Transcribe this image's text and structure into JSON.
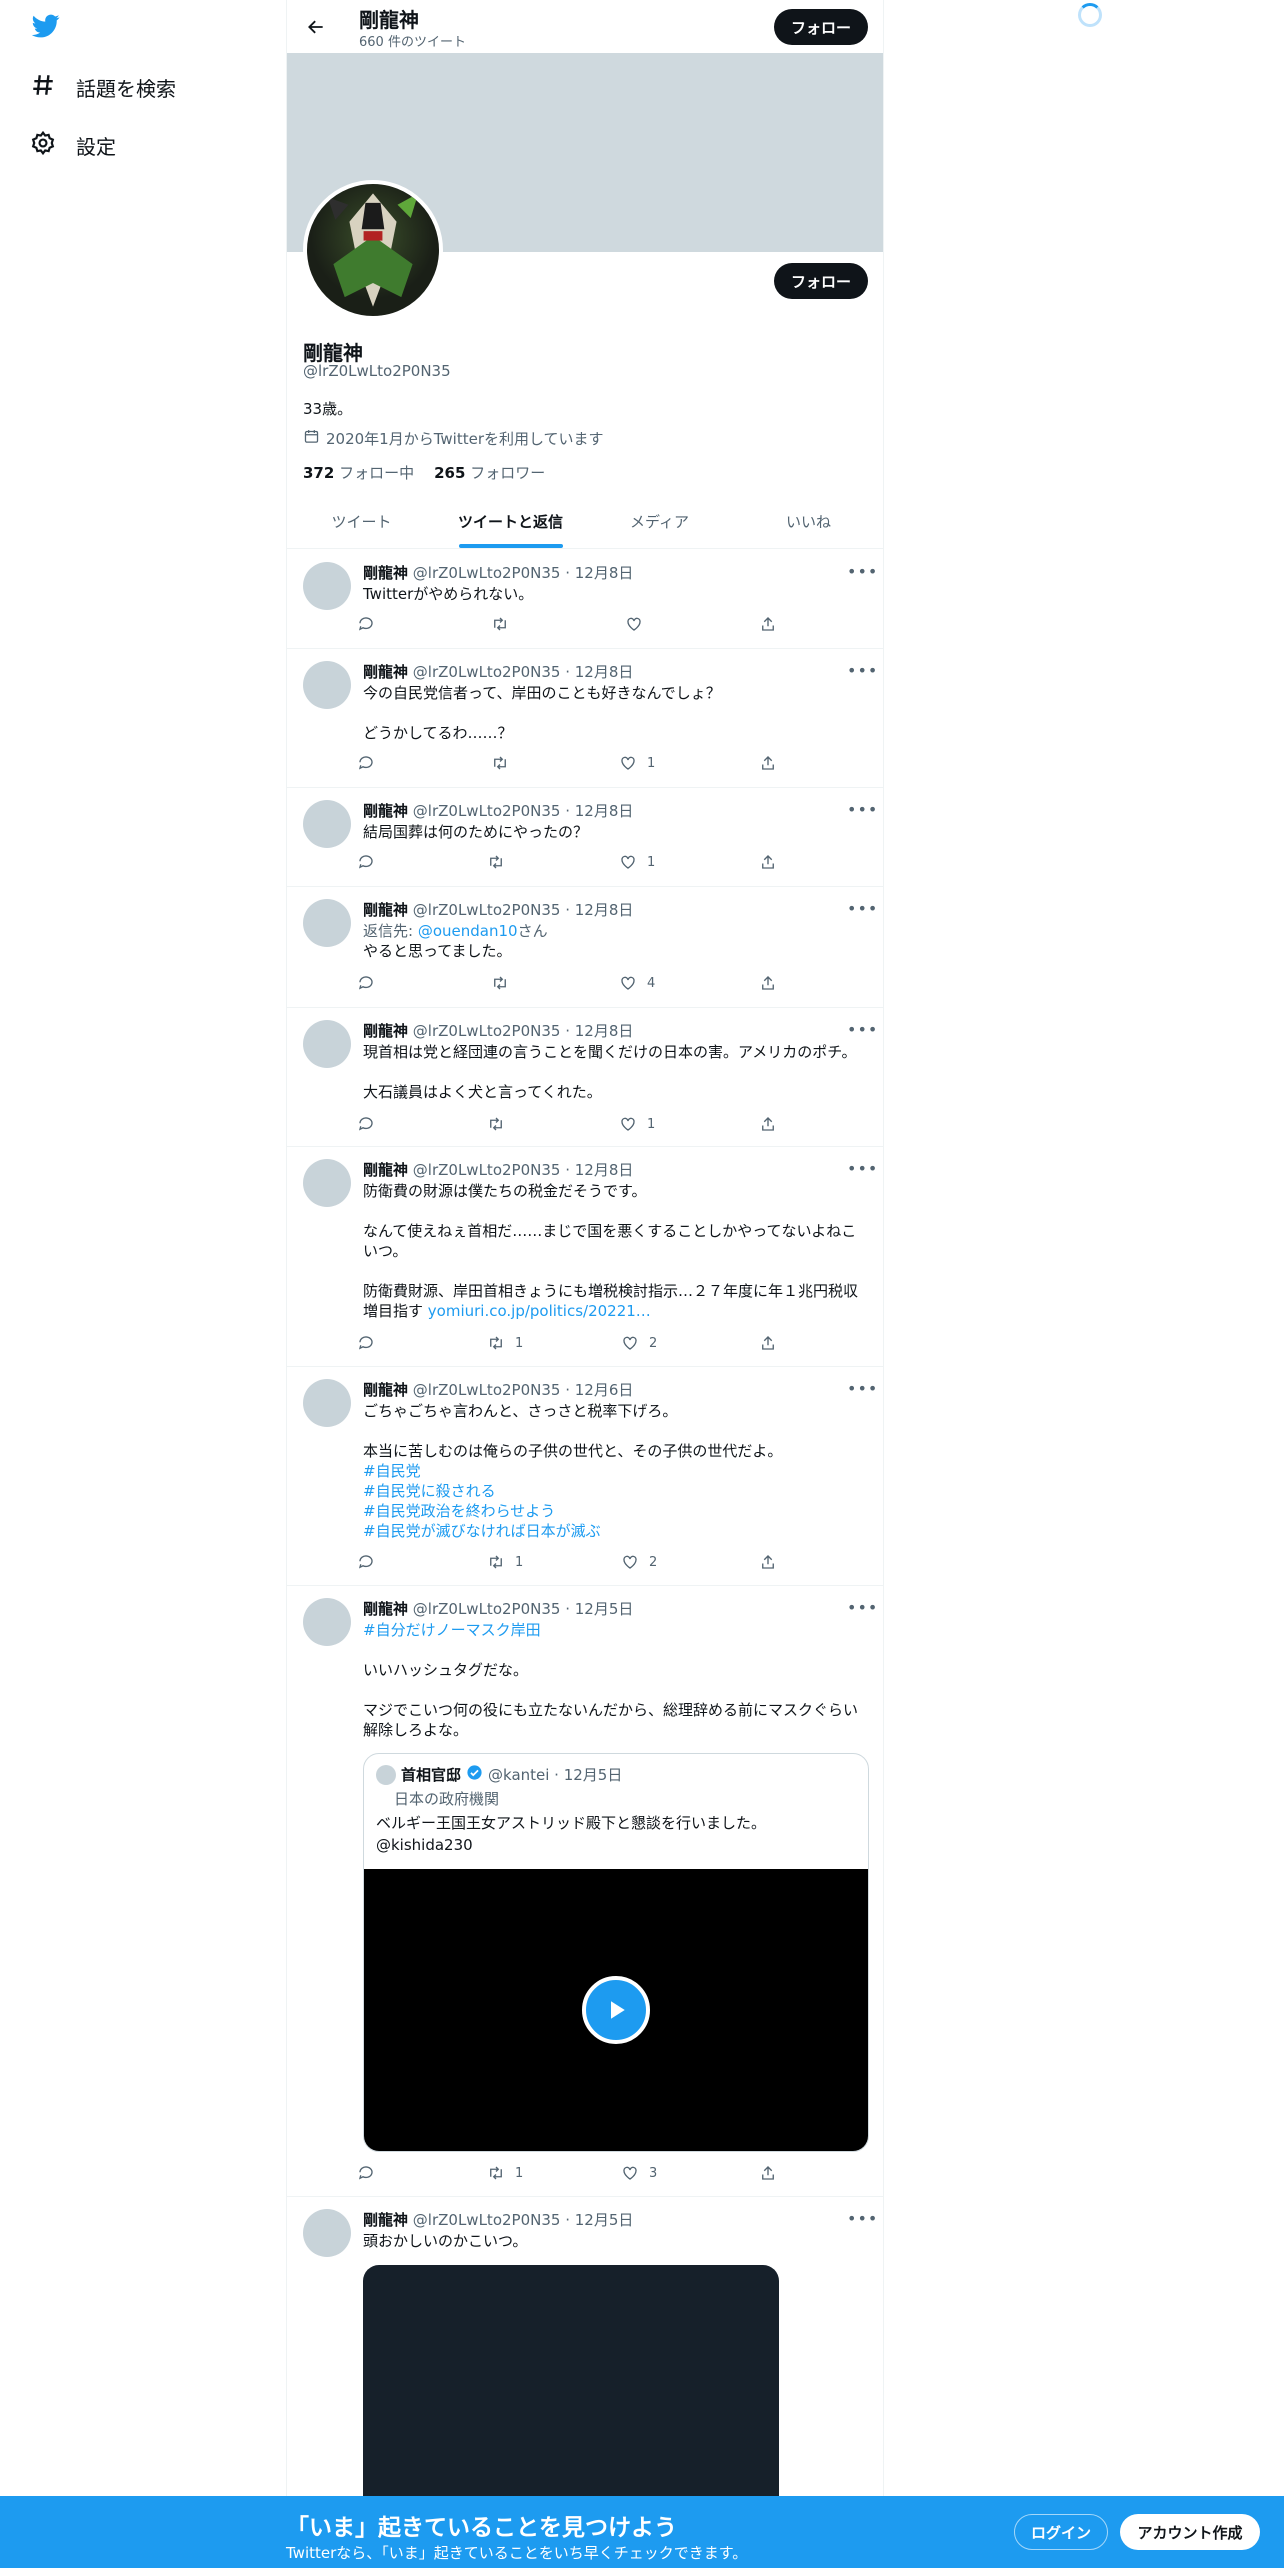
{
  "nav": {
    "items": [
      {
        "label": "話題を検索",
        "icon": "hashtag-icon"
      },
      {
        "label": "設定",
        "icon": "gear-icon"
      }
    ]
  },
  "header": {
    "name": "剛龍神",
    "tweet_count": "660 件のツイート",
    "follow_label": "フォロー"
  },
  "profile": {
    "name": "剛龍神",
    "handle": "@lrZ0LwLto2P0N35",
    "bio": "33歳。",
    "joined": "2020年1月からTwitterを利用しています",
    "following_count": "372",
    "following_label": "フォロー中",
    "followers_count": "265",
    "followers_label": "フォロワー",
    "follow_label": "フォロー"
  },
  "tabs": [
    {
      "label": "ツイート",
      "active": false
    },
    {
      "label": "ツイートと返信",
      "active": true
    },
    {
      "label": "メディア",
      "active": false
    },
    {
      "label": "いいね",
      "active": false
    }
  ],
  "tweets": [
    {
      "name": "剛龍神",
      "meta": "@lrZ0LwLto2P0N35 · 12月8日",
      "text": "Twitterがやめられない。",
      "retweets": "",
      "likes": ""
    },
    {
      "name": "剛龍神",
      "meta": "@lrZ0LwLto2P0N35 · 12月8日",
      "text": "今の自民党信者って、岸田のことも好きなんでしょ？\n\nどうかしてるわ……？",
      "retweets": "",
      "likes": "1"
    },
    {
      "name": "剛龍神",
      "meta": "@lrZ0LwLto2P0N35 · 12月8日",
      "text": "結局国葬は何のためにやったの？",
      "retweets": "",
      "likes": "1"
    },
    {
      "name": "剛龍神",
      "meta": "@lrZ0LwLto2P0N35 · 12月8日",
      "reply_prefix": "返信先: ",
      "reply_to": "@ouendan10",
      "reply_suffix": "さん",
      "text": "やると思ってました。",
      "retweets": "",
      "likes": "4"
    },
    {
      "name": "剛龍神",
      "meta": "@lrZ0LwLto2P0N35 · 12月8日",
      "text": "現首相は党と経団連の言うことを聞くだけの日本の害。アメリカのポチ。\n\n大石議員はよく犬と言ってくれた。",
      "retweets": "",
      "likes": "1"
    },
    {
      "name": "剛龍神",
      "meta": "@lrZ0LwLto2P0N35 · 12月8日",
      "text": "防衛費の財源は僕たちの税金だそうです。\n\nなんて使えねぇ首相だ……まじで国を悪くすることしかやってないよねこいつ。\n\n防衛費財源、岸田首相きょうにも増税検討指示…２７年度に年１兆円税収増目指す ",
      "link": "yomiuri.co.jp/politics/20221…",
      "retweets": "1",
      "likes": "2"
    },
    {
      "name": "剛龍神",
      "meta": "@lrZ0LwLto2P0N35 · 12月6日",
      "text": "ごちゃごちゃ言わんと、さっさと税率下げろ。\n\n本当に苦しむのは俺らの子供の世代と、その子供の世代だよ。",
      "hashtags": [
        "#自民党",
        "#自民党に殺される",
        "#自民党政治を終わらせよう",
        "#自民党が滅びなければ日本が滅ぶ"
      ],
      "retweets": "1",
      "likes": "2"
    },
    {
      "name": "剛龍神",
      "meta": "@lrZ0LwLto2P0N35 · 12月5日",
      "hashtag_first": "#自分だけノーマスク岸田",
      "text": "いいハッシュタグだな。\n\nマジでこいつ何の役にも立たないんだから、総理辞める前にマスクぐらい解除しろよな。",
      "quote": {
        "name": "首相官邸",
        "meta": "@kantei · 12月5日",
        "affiliation": "日本の政府機関",
        "text": "ベルギー王国王女アストリッド殿下と懇談を行いました。",
        "mention": "@kishida230"
      },
      "retweets": "1",
      "likes": "3"
    },
    {
      "name": "剛龍神",
      "meta": "@lrZ0LwLto2P0N35 · 12月5日",
      "text": "頭おかしいのかこいつ。",
      "retweets": "",
      "likes": ""
    }
  ],
  "bottom_bar": {
    "title": "「いま」起きていることを見つけよう",
    "subtitle": "Twitterなら、「いま」起きていることをいち早くチェックできます。",
    "login_label": "ログイン",
    "signup_label": "アカウント作成"
  },
  "colors": {
    "accent": "#1d9bf0",
    "banner": "#cfd9de",
    "text": "#0f1419",
    "muted": "#536471"
  }
}
